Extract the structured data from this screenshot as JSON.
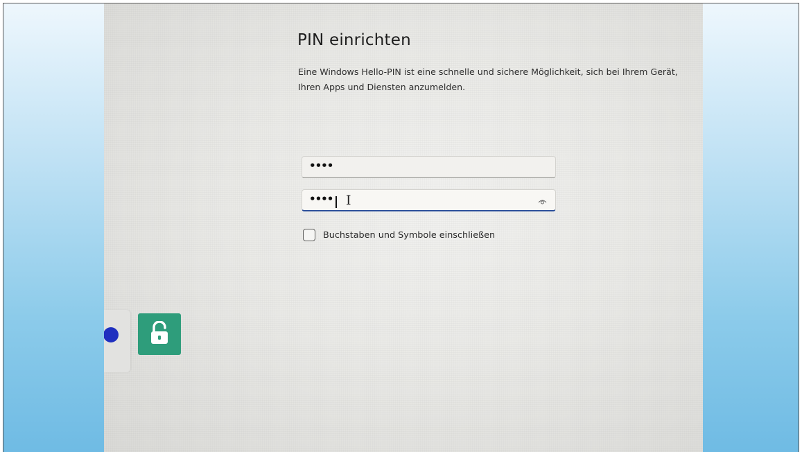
{
  "setup": {
    "title": "PIN einrichten",
    "description": "Eine Windows Hello-PIN ist eine schnelle und sichere Möglichkeit, sich bei Ihrem Gerät, Ihren Apps und Diensten anzumelden.",
    "pin_field": {
      "value": "••••"
    },
    "confirm_pin_field": {
      "value": "••••"
    },
    "include_letters_checkbox": {
      "label": "Buchstaben und Symbole einschließen",
      "checked": false
    }
  },
  "icons": {
    "reveal": "eye-icon",
    "unlock": "unlock-icon",
    "text_cursor": "text-cursor-icon"
  },
  "colors": {
    "focus_underline": "#2b4f9a",
    "lock_tile": "#2e9d7b",
    "blue_dot": "#1f2fbf"
  }
}
